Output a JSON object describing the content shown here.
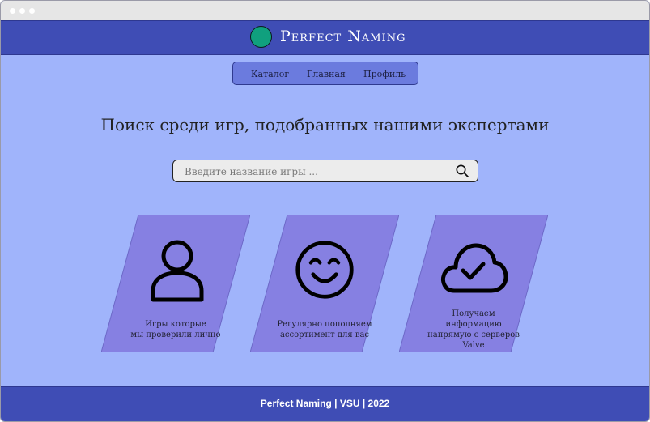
{
  "window": {
    "controls": [
      "window-dot",
      "window-dot",
      "window-dot"
    ]
  },
  "header": {
    "logo_icon": "green-circle-logo",
    "brand": "Perfect Naming"
  },
  "nav": {
    "items": [
      {
        "label": "Каталог"
      },
      {
        "label": "Главная"
      },
      {
        "label": "Профиль"
      }
    ]
  },
  "main": {
    "headline": "Поиск среди игр, подобранных нашими экспертами",
    "search": {
      "placeholder": "Введите название игры ...",
      "value": "",
      "icon": "search-icon"
    },
    "features": [
      {
        "icon": "user-icon",
        "text_line1": "Игры которые",
        "text_line2": "мы проверили лично"
      },
      {
        "icon": "smiley-icon",
        "text_line1": "Регулярно пополняем",
        "text_line2": "ассортимент для вас"
      },
      {
        "icon": "cloud-check-icon",
        "text_line1": "Получаем",
        "text_line2": "информацию",
        "text_line3": "напрямую с серверов",
        "text_line4": "Valve"
      }
    ]
  },
  "footer": {
    "text": "Perfect Naming | VSU | 2022"
  },
  "colors": {
    "page_bg": "#a0b4fb",
    "header_bg": "#3f4db5",
    "nav_bg": "#6b7bde",
    "card_bg": "#8680e2",
    "logo": "#10a07e"
  }
}
